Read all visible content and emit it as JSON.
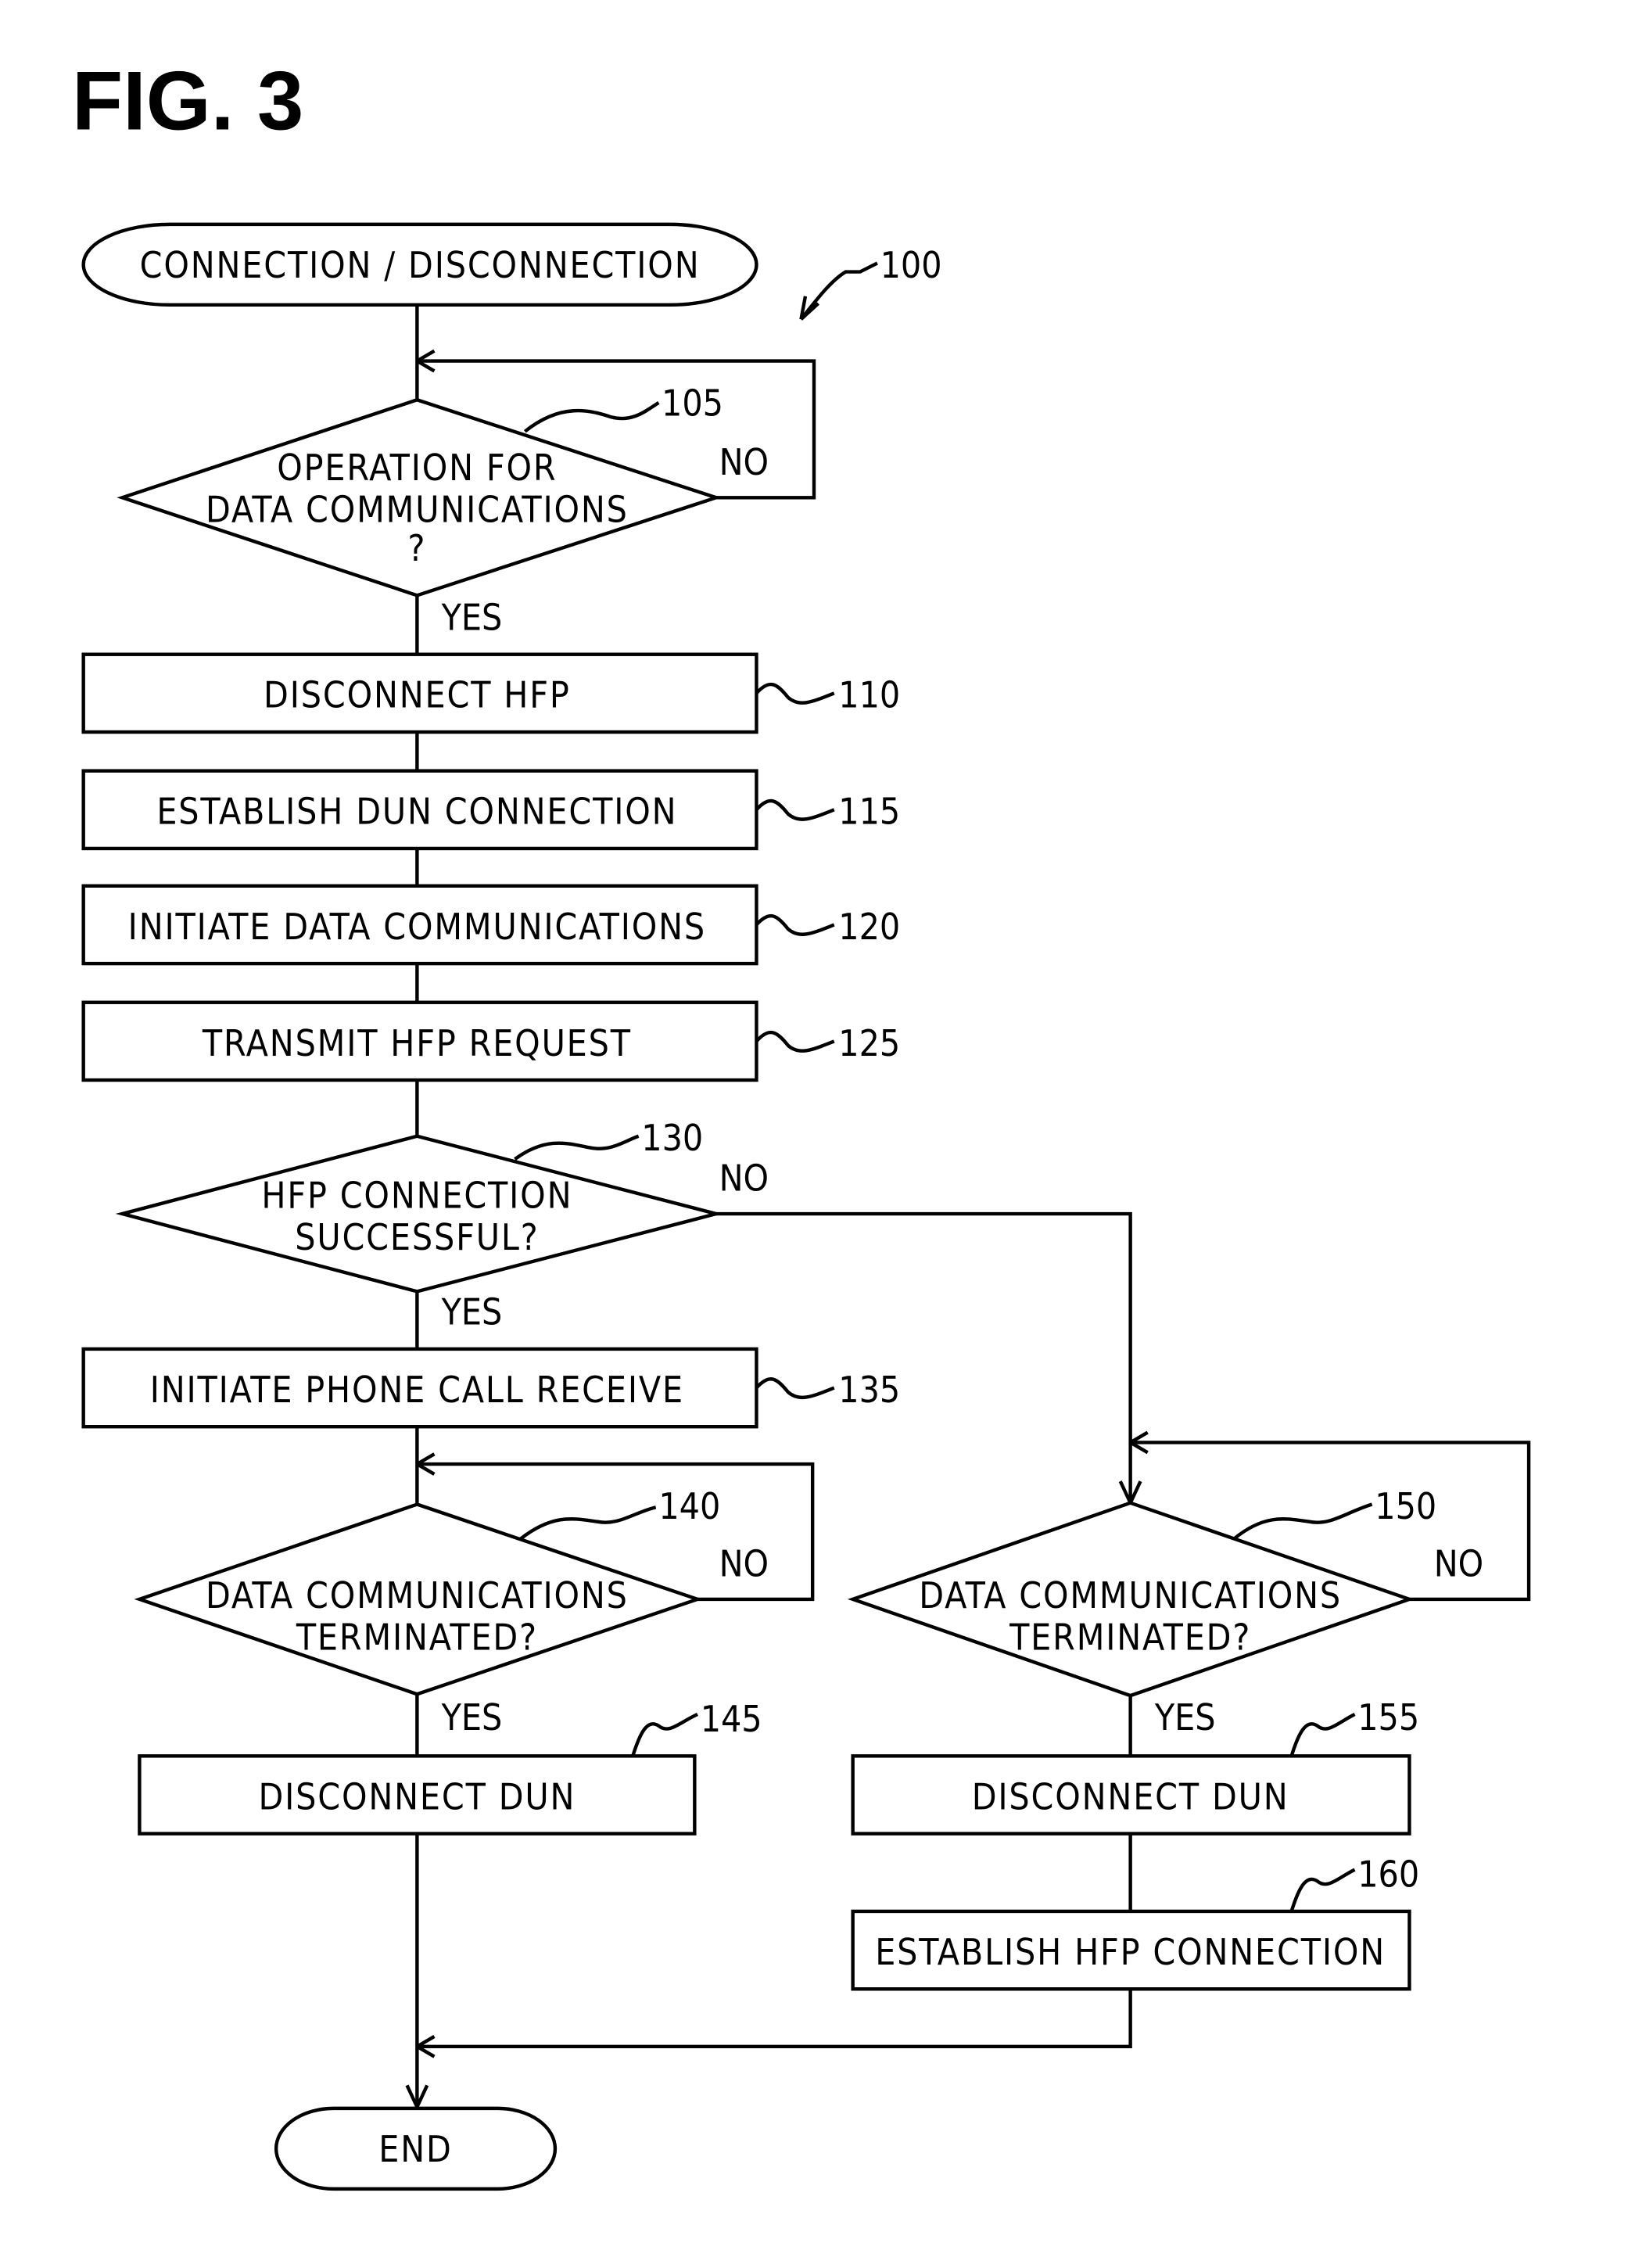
{
  "figure": {
    "title": "FIG. 3",
    "reference": "100"
  },
  "nodes": {
    "start": {
      "text": "CONNECTION / DISCONNECTION"
    },
    "d105": {
      "ref": "105",
      "lines": [
        "OPERATION FOR",
        "DATA COMMUNICATIONS",
        "?"
      ],
      "yes": "YES",
      "no": "NO"
    },
    "s110": {
      "ref": "110",
      "text": "DISCONNECT HFP"
    },
    "s115": {
      "ref": "115",
      "text": "ESTABLISH DUN CONNECTION"
    },
    "s120": {
      "ref": "120",
      "text": "INITIATE DATA COMMUNICATIONS"
    },
    "s125": {
      "ref": "125",
      "text": "TRANSMIT HFP REQUEST"
    },
    "d130": {
      "ref": "130",
      "lines": [
        "HFP CONNECTION",
        "SUCCESSFUL?"
      ],
      "yes": "YES",
      "no": "NO"
    },
    "s135": {
      "ref": "135",
      "text": "INITIATE PHONE CALL RECEIVE"
    },
    "d140": {
      "ref": "140",
      "lines": [
        "DATA COMMUNICATIONS",
        "TERMINATED?"
      ],
      "yes": "YES",
      "no": "NO"
    },
    "s145": {
      "ref": "145",
      "text": "DISCONNECT DUN"
    },
    "d150": {
      "ref": "150",
      "lines": [
        "DATA COMMUNICATIONS",
        "TERMINATED?"
      ],
      "yes": "YES",
      "no": "NO"
    },
    "s155": {
      "ref": "155",
      "text": "DISCONNECT DUN"
    },
    "s160": {
      "ref": "160",
      "text": "ESTABLISH HFP CONNECTION"
    },
    "end": {
      "text": "END"
    }
  }
}
